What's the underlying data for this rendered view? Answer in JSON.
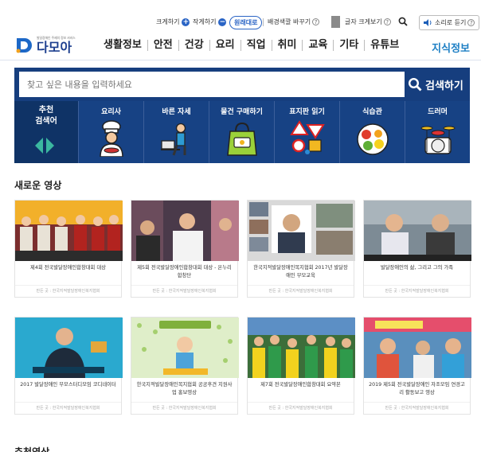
{
  "utility": {
    "bigger": "크게하기",
    "smaller": "작게하기",
    "original": "원래대로",
    "background": "배경색깔 바꾸기",
    "text_size": "글자 크게보기",
    "listen": "소리로 듣기"
  },
  "logo": {
    "tagline": "발달장애인 주제의 정보 서비스",
    "name": "다모아"
  },
  "nav": {
    "items": [
      "생활정보",
      "안전",
      "건강",
      "요리",
      "직업",
      "취미",
      "교육",
      "기타",
      "유튜브"
    ],
    "knowledge": "지식정보"
  },
  "search": {
    "placeholder": "찾고 싶은 내용을 입력하세요",
    "button": "검색하기"
  },
  "recommend": {
    "line1": "추천",
    "line2": "검색어"
  },
  "categories": [
    {
      "label": "요리사",
      "icon": "chef-icon"
    },
    {
      "label": "바른 자세",
      "icon": "posture-icon"
    },
    {
      "label": "물건 구매하기",
      "icon": "shopping-bag-icon"
    },
    {
      "label": "표지판 읽기",
      "icon": "traffic-sign-icon"
    },
    {
      "label": "식습관",
      "icon": "food-plate-icon"
    },
    {
      "label": "드러머",
      "icon": "drum-icon"
    }
  ],
  "section": {
    "title": "새로운 영상"
  },
  "videos": [
    {
      "title": "제4회 전국발달장애인합창대회 대상",
      "source": "만든 곳 : 한국지적발달장애인복지협회"
    },
    {
      "title": "제5회 전국발달장애인합창대회 대상 - 온누리합창단",
      "source": "만든 곳 : 한국지적발달장애인복지협회"
    },
    {
      "title": "한국지적발달장애인복지협회 2017년 발달장애인 부모교육",
      "source": "만든 곳 : 한국지적발달장애인복지협회"
    },
    {
      "title": "발달장애인의 삶, 그리고 그의 가족",
      "source": "만든 곳 : 한국지적발달장애인복지협회"
    },
    {
      "title": "2017 발달장애인 부모스터디모임 코디네이터",
      "source": "만든 곳 : 한국지적발달장애인복지협회"
    },
    {
      "title": "한국지적발달장애인복지협회 공공후견 지원사업 홍보영상",
      "source": "만든 곳 : 한국지적발달장애인복지협회"
    },
    {
      "title": "제7회 전국발달장애인합창대회 요약본",
      "source": "만든 곳 : 한국지적발달장애인복지협회"
    },
    {
      "title": "2019 제5회 전국발달장애인 자조모임 연경고리 활동보고 영상",
      "source": "만든 곳 : 한국지적발달장애인복지협회"
    }
  ],
  "next_section": {
    "title": "추천영상"
  }
}
